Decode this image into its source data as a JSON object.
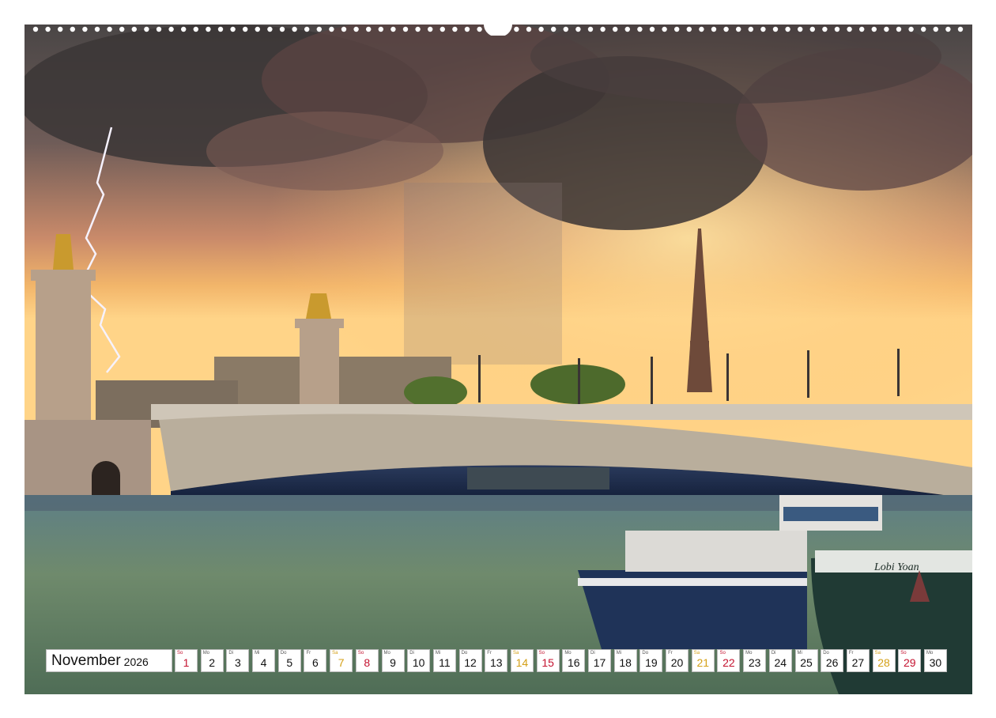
{
  "calendar": {
    "month": "November",
    "year": "2026",
    "days": [
      {
        "wd": "So",
        "n": "1",
        "t": "sun"
      },
      {
        "wd": "Mo",
        "n": "2",
        "t": ""
      },
      {
        "wd": "Di",
        "n": "3",
        "t": ""
      },
      {
        "wd": "Mi",
        "n": "4",
        "t": ""
      },
      {
        "wd": "Do",
        "n": "5",
        "t": ""
      },
      {
        "wd": "Fr",
        "n": "6",
        "t": ""
      },
      {
        "wd": "Sa",
        "n": "7",
        "t": "sat"
      },
      {
        "wd": "So",
        "n": "8",
        "t": "sun"
      },
      {
        "wd": "Mo",
        "n": "9",
        "t": ""
      },
      {
        "wd": "Di",
        "n": "10",
        "t": ""
      },
      {
        "wd": "Mi",
        "n": "11",
        "t": ""
      },
      {
        "wd": "Do",
        "n": "12",
        "t": ""
      },
      {
        "wd": "Fr",
        "n": "13",
        "t": ""
      },
      {
        "wd": "Sa",
        "n": "14",
        "t": "sat"
      },
      {
        "wd": "So",
        "n": "15",
        "t": "sun"
      },
      {
        "wd": "Mo",
        "n": "16",
        "t": ""
      },
      {
        "wd": "Di",
        "n": "17",
        "t": ""
      },
      {
        "wd": "Mi",
        "n": "18",
        "t": ""
      },
      {
        "wd": "Do",
        "n": "19",
        "t": ""
      },
      {
        "wd": "Fr",
        "n": "20",
        "t": ""
      },
      {
        "wd": "Sa",
        "n": "21",
        "t": "sat"
      },
      {
        "wd": "So",
        "n": "22",
        "t": "sun"
      },
      {
        "wd": "Mo",
        "n": "23",
        "t": ""
      },
      {
        "wd": "Di",
        "n": "24",
        "t": ""
      },
      {
        "wd": "Mi",
        "n": "25",
        "t": ""
      },
      {
        "wd": "Do",
        "n": "26",
        "t": ""
      },
      {
        "wd": "Fr",
        "n": "27",
        "t": ""
      },
      {
        "wd": "Sa",
        "n": "28",
        "t": "sat"
      },
      {
        "wd": "So",
        "n": "29",
        "t": "sun"
      },
      {
        "wd": "Mo",
        "n": "30",
        "t": ""
      }
    ]
  },
  "photo": {
    "boat_name": "Lobi Yoan"
  },
  "colors": {
    "saturday": "#d4a017",
    "sunday": "#c4122f"
  }
}
